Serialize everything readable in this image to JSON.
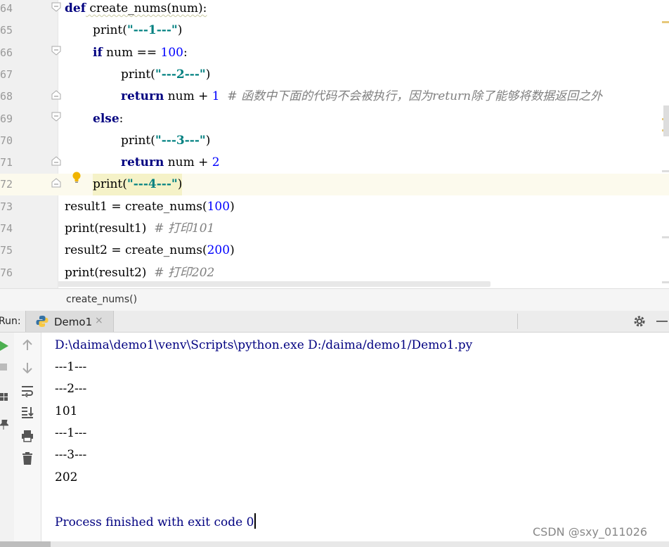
{
  "editor": {
    "lines": [
      {
        "n": "64",
        "segs": [
          {
            "t": "def",
            "c": "kw"
          },
          {
            "t": " create_nums(num):",
            "c": "sq"
          }
        ]
      },
      {
        "n": "65",
        "segs": [
          {
            "t": "print(",
            "c": "fn"
          },
          {
            "t": "\"---1---\"",
            "c": "str"
          },
          {
            "t": ")",
            "c": "fn"
          }
        ]
      },
      {
        "n": "66",
        "segs": [
          {
            "t": "if",
            "c": "kw"
          },
          {
            "t": " num == ",
            "c": "fn"
          },
          {
            "t": "100",
            "c": "num"
          },
          {
            "t": ":",
            "c": "fn"
          }
        ]
      },
      {
        "n": "67",
        "segs": [
          {
            "t": "print(",
            "c": "fn"
          },
          {
            "t": "\"---2---\"",
            "c": "str"
          },
          {
            "t": ")",
            "c": "fn"
          }
        ]
      },
      {
        "n": "68",
        "segs": [
          {
            "t": "return",
            "c": "kw"
          },
          {
            "t": " num + ",
            "c": "fn"
          },
          {
            "t": "1",
            "c": "num"
          },
          {
            "t": "  # 函数中下面的代码不会被执行，因为return除了能够将数据返回之外",
            "c": "cmt"
          }
        ]
      },
      {
        "n": "69",
        "segs": [
          {
            "t": "else",
            "c": "kw"
          },
          {
            "t": ":",
            "c": "fn"
          }
        ]
      },
      {
        "n": "70",
        "segs": [
          {
            "t": "print(",
            "c": "fn"
          },
          {
            "t": "\"---3---\"",
            "c": "str"
          },
          {
            "t": ")",
            "c": "fn"
          }
        ]
      },
      {
        "n": "71",
        "segs": [
          {
            "t": "return",
            "c": "kw"
          },
          {
            "t": " num + ",
            "c": "fn"
          },
          {
            "t": "2",
            "c": "num"
          }
        ]
      },
      {
        "n": "72",
        "segs": [
          {
            "t": "print(",
            "c": "fn"
          },
          {
            "t": "\"---4---\"",
            "c": "str"
          },
          {
            "t": ")",
            "c": "fn"
          }
        ]
      },
      {
        "n": "73",
        "segs": [
          {
            "t": "result1 = create_nums(",
            "c": "fn"
          },
          {
            "t": "100",
            "c": "num"
          },
          {
            "t": ")",
            "c": "fn"
          }
        ]
      },
      {
        "n": "74",
        "segs": [
          {
            "t": "print(result1)  ",
            "c": "fn"
          },
          {
            "t": "# 打印101",
            "c": "cmt"
          }
        ]
      },
      {
        "n": "75",
        "segs": [
          {
            "t": "result2 = create_nums(",
            "c": "fn"
          },
          {
            "t": "200",
            "c": "num"
          },
          {
            "t": ")",
            "c": "fn"
          }
        ]
      },
      {
        "n": "76",
        "segs": [
          {
            "t": "print(result2)  ",
            "c": "fn"
          },
          {
            "t": "# 打印202",
            "c": "cmt"
          }
        ]
      }
    ]
  },
  "breadcrumb": {
    "text": "create_nums()"
  },
  "run_panel": {
    "label": "Run:",
    "tab_name": "Demo1",
    "tab_close": "×"
  },
  "console": {
    "command": "D:\\daima\\demo1\\venv\\Scripts\\python.exe D:/daima/demo1/Demo1.py",
    "output": [
      "---1---",
      "---2---",
      "101",
      "---1---",
      "---3---",
      "202"
    ],
    "exit_message": "Process finished with exit code 0"
  },
  "watermark": "CSDN @sxy_011026",
  "colors": {
    "keyword": "#000080",
    "string": "#008080",
    "number": "#0000ff",
    "comment": "#808080",
    "highlight_line": "#fcfaed",
    "run_green": "#4caf50"
  }
}
